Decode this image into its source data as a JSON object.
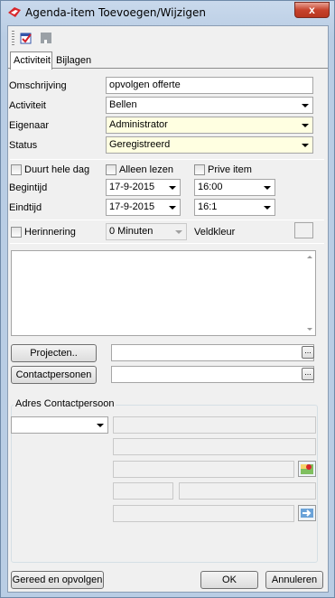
{
  "window": {
    "title": "Agenda-item Toevoegen/Wijzigen",
    "close_label": "x"
  },
  "tabs": [
    {
      "label": "Activiteit"
    },
    {
      "label": "Bijlagen"
    }
  ],
  "form": {
    "omschrijving": {
      "label": "Omschrijving",
      "value": "opvolgen offerte"
    },
    "activiteit": {
      "label": "Activiteit",
      "value": "Bellen"
    },
    "eigenaar": {
      "label": "Eigenaar",
      "value": "Administrator"
    },
    "status": {
      "label": "Status",
      "value": "Geregistreerd"
    },
    "duurt_hele_dag": {
      "label": "Duurt hele dag"
    },
    "alleen_lezen": {
      "label": "Alleen lezen"
    },
    "prive_item": {
      "label": "Prive item"
    },
    "begintijd": {
      "label": "Begintijd",
      "date": "17-9-2015",
      "time": "16:00"
    },
    "eindtijd": {
      "label": "Eindtijd",
      "date": "17-9-2015",
      "time": "16:1"
    },
    "herinnering": {
      "label": "Herinnering",
      "value": "0 Minuten"
    },
    "veldkleur": {
      "label": "Veldkleur"
    }
  },
  "buttons": {
    "projecten": "Projecten..",
    "contactpersonen": "Contactpersonen",
    "ellipsis": "...",
    "gereed": "Gereed en opvolgen",
    "ok": "OK",
    "annuleren": "Annuleren"
  },
  "adres": {
    "title": "Adres Contactpersoon"
  },
  "colors": {
    "required_bg": "#ffffe1",
    "field_border": "#a5a5a5"
  }
}
